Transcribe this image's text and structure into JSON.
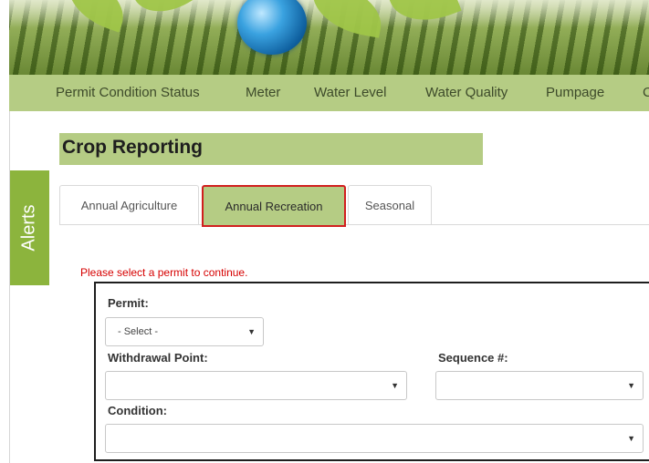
{
  "nav": {
    "items": [
      "Permit Condition Status",
      "Meter",
      "Water Level",
      "Water Quality",
      "Pumpage",
      "C"
    ]
  },
  "page_title": "Crop Reporting",
  "alerts_label": "Alerts",
  "tabs": [
    {
      "label": "Annual Agriculture",
      "active": false
    },
    {
      "label": "Annual Recreation",
      "active": true
    },
    {
      "label": "Seasonal",
      "active": false
    }
  ],
  "warning": "Please select a permit to continue.",
  "form": {
    "permit_label": "Permit:",
    "permit_value": "- Select -",
    "withdrawal_label": "Withdrawal Point:",
    "withdrawal_value": "",
    "sequence_label": "Sequence #:",
    "sequence_value": "",
    "condition_label": "Condition:",
    "condition_value": ""
  },
  "icons": {
    "dropdown": "chevron-down-icon",
    "banner_globe": "globe-icon"
  },
  "colors": {
    "nav_bg": "#b5cc84",
    "alerts_bg": "#8cb43d",
    "highlight_border": "#d11f1f",
    "warning_text": "#d60000"
  }
}
